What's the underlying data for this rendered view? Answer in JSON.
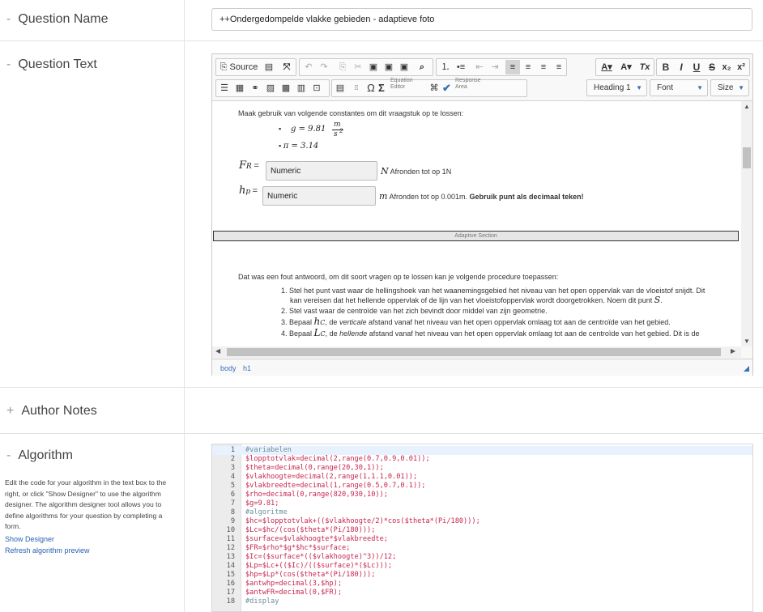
{
  "sections": {
    "question_name": {
      "label": "Question Name",
      "toggle": "-",
      "value": "++Ondergedompelde vlakke gebieden - adaptieve foto"
    },
    "question_text": {
      "label": "Question Text",
      "toggle": "-"
    },
    "author_notes": {
      "label": "Author Notes",
      "toggle": "+"
    },
    "algorithm": {
      "label": "Algorithm",
      "toggle": "-"
    }
  },
  "toolbar": {
    "source_label": "Source",
    "heading_combo": "Heading 1",
    "font_combo": "Font",
    "size_combo": "Size",
    "equation_label_1": "Equation",
    "equation_label_2": "Editor",
    "response_label_1": "Response",
    "response_label_2": "Area",
    "font_color_label": "A",
    "bg_color_label": "A",
    "clear_format_label": "Tx",
    "bold_label": "B",
    "italic_label": "I",
    "underline_label": "U",
    "strike_label": "S",
    "subscript_label": "x₂",
    "superscript_label": "x²"
  },
  "editor_content": {
    "intro": "Maak gebruik van volgende constantes om dit vraagstuk op te lossen:",
    "const_g_lhs": "g = 9.81",
    "const_g_num": "m",
    "const_g_den": "s",
    "const_g_exp": "2",
    "const_pi": "π = 3.14",
    "fr_label": "F",
    "fr_sub": "R",
    "fr_eq": "=",
    "fr_input": "Numeric",
    "fr_unit": "N",
    "fr_note": "Afronden tot op 1N",
    "hp_label": "h",
    "hp_sub": "p",
    "hp_eq": "=",
    "hp_input": "Numeric",
    "hp_unit": "m",
    "hp_note": "Afronden tot op 0.001m.",
    "hp_note_bold": "Gebruik punt als decimaal teken!",
    "adaptive_label": "Adaptive Section",
    "wrong_intro": "Dat was een fout antwoord, om dit soort vragen op te lossen kan je volgende procedure toepassen:",
    "step1_a": "1. Stel het punt vast waar de hellingshoek van het waanemingsgebied het niveau van het open oppervlak van de vloeistof snijdt. Dit",
    "step1_b": "kan vereisen dat het hellende oppervlak of de lijn van het vloeistofoppervlak wordt doorgetrokken. Noem dit punt",
    "step1_s": "S",
    "step2": "2. Stel vast waar de centroïde van het zich bevindt door middel van zijn geometrie.",
    "step3_a": "3. Bepaal",
    "step3_h": "h",
    "step3_sub": "C",
    "step3_b": ", de",
    "step3_em": "verticale",
    "step3_c": "afstand vanaf het niveau van het open oppervlak omlaag tot aan de centroïde van het gebied.",
    "step4_a": "4. Bepaal",
    "step4_l": "L",
    "step4_sub": "C",
    "step4_b": ", de",
    "step4_em": "hellende",
    "step4_c": "afstand vanaf het niveau van het open oppervlak omlaag tot aan de centroïde van het gebied. Dit is de"
  },
  "path_bar": [
    "body",
    "h1"
  ],
  "algorithm_help": "Edit the code for your algorithm in the text box to the right, or click \"Show Designer\" to use the algorithm designer. The algorithm designer tool allows you to define algorithms for your question by completing a form.",
  "show_designer": "Show Designer",
  "refresh_preview": "Refresh algorithm preview",
  "code_lines": [
    {
      "n": "1",
      "t": "#variabelen",
      "c": true
    },
    {
      "n": "2",
      "t": "$lopptotvlak=decimal(2,range(0.7,0.9,0.01));",
      "c": false
    },
    {
      "n": "3",
      "t": "$theta=decimal(0,range(20,30,1));",
      "c": false
    },
    {
      "n": "4",
      "t": "$vlakhoogte=decimal(2,range(1,1.1,0.01));",
      "c": false
    },
    {
      "n": "5",
      "t": "$vlakbreedte=decimal(1,range(0.5,0.7,0.1));",
      "c": false
    },
    {
      "n": "6",
      "t": "$rho=decimal(0,range(820,930,10));",
      "c": false
    },
    {
      "n": "7",
      "t": "$g=9.81;",
      "c": false
    },
    {
      "n": "8",
      "t": "#algoritme",
      "c": true
    },
    {
      "n": "9",
      "t": "$hc=$lopptotvlak+(($vlakhoogte/2)*cos($theta*(Pi/180)));",
      "c": false
    },
    {
      "n": "10",
      "t": "$Lc=$hc/(cos($theta*(Pi/180)));",
      "c": false
    },
    {
      "n": "11",
      "t": "$surface=$vlakhoogte*$vlakbreedte;",
      "c": false
    },
    {
      "n": "12",
      "t": "$FR=$rho*$g*$hc*$surface;",
      "c": false
    },
    {
      "n": "13",
      "t": "$Ic=($surface*(($vlakhoogte)^3))/12;",
      "c": false
    },
    {
      "n": "14",
      "t": "$Lp=$Lc+(($Ic)/(($surface)*($Lc)));",
      "c": false
    },
    {
      "n": "15",
      "t": "$hp=$Lp*(cos($theta*(Pi/180)));",
      "c": false
    },
    {
      "n": "16",
      "t": "$antwhp=decimal(3,$hp);",
      "c": false
    },
    {
      "n": "17",
      "t": "$antwFR=decimal(0,$FR);",
      "c": false
    },
    {
      "n": "18",
      "t": "#display",
      "c": true
    }
  ]
}
